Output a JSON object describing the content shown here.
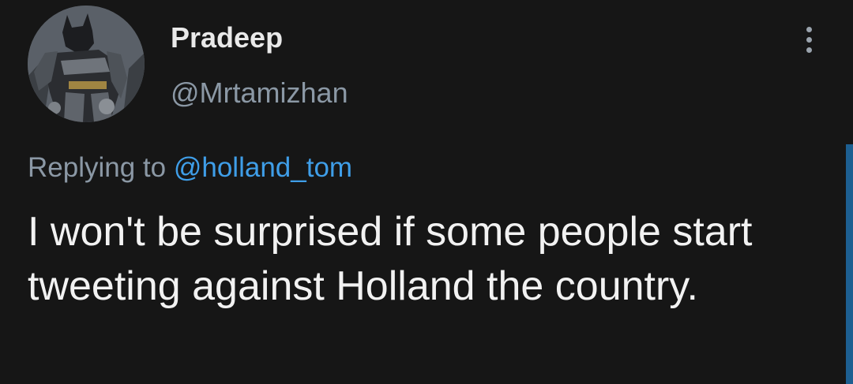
{
  "tweet": {
    "display_name": "Pradeep",
    "handle": "@Mrtamizhan",
    "reply_prefix": "Replying to",
    "reply_mention": "@holland_tom",
    "text": "I won't be surprised if some people start tweeting against Holland the country."
  },
  "icons": {
    "avatar": "batman-avatar-icon",
    "more": "more-vertical-icon"
  },
  "colors": {
    "background": "#161616",
    "name": "#e9e9e9",
    "secondary": "#8b98a5",
    "mention": "#3f9ee8",
    "scrollbar": "#1d5f91"
  }
}
